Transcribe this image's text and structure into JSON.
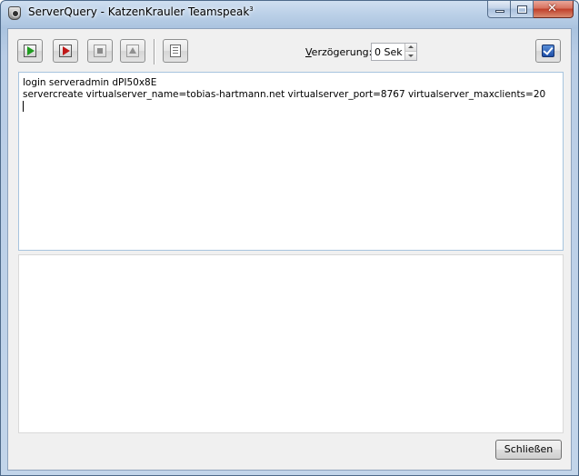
{
  "window": {
    "title": "ServerQuery - KatzenKrauler Teamspeak",
    "title_superscript": "3"
  },
  "caption_buttons": {
    "minimize": "minimize-icon",
    "maximize": "maximize-icon",
    "close": "close-icon",
    "close_glyph": "✕"
  },
  "toolbar": {
    "buttons": [
      {
        "name": "run-button",
        "icon": "play-green-icon"
      },
      {
        "name": "run-step-button",
        "icon": "play-red-icon"
      },
      {
        "name": "stop-button",
        "icon": "stop-icon",
        "disabled": true
      },
      {
        "name": "eject-button",
        "icon": "eject-icon",
        "disabled": true
      },
      {
        "name": "log-button",
        "icon": "document-icon"
      },
      {
        "name": "confirm-button",
        "icon": "checkbox-icon"
      }
    ],
    "delay_label_prefix": "V",
    "delay_label_rest": "erzögerung:",
    "delay_value": "0 Sek"
  },
  "editor": {
    "lines": [
      "login serveradmin dPI50x8E",
      "servercreate virtualserver_name=tobias-hartmann.net virtualserver_port=8767 virtualserver_maxclients=20"
    ]
  },
  "footer": {
    "close_label": "Schließen"
  }
}
